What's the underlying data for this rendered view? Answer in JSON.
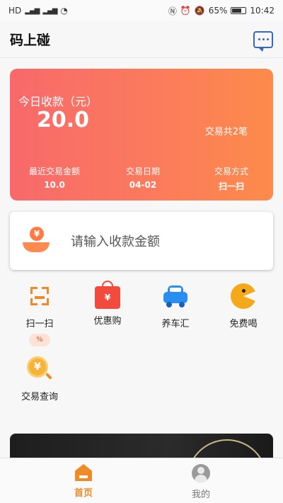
{
  "status_bar": {
    "left": "HD",
    "battery": "65%",
    "time": "10:42"
  },
  "header": {
    "title": "码上碰",
    "message_icon": "message-icon"
  },
  "summary": {
    "label": "今日收款（元）",
    "amount": "20.0",
    "count_text": "交易共2笔",
    "stats": [
      {
        "label": "最近交易金额",
        "value": "10.0"
      },
      {
        "label": "交易日期",
        "value": "04-02"
      },
      {
        "label": "交易方式",
        "value": "扫一扫"
      }
    ]
  },
  "amount_input": {
    "placeholder": "请输入收款金额",
    "icon": "hand-coin-icon"
  },
  "features": [
    {
      "label": "扫一扫",
      "icon": "scan-icon",
      "badge": "%"
    },
    {
      "label": "优惠购",
      "icon": "shopping-bag-icon"
    },
    {
      "label": "养车汇",
      "icon": "car-icon"
    },
    {
      "label": "免费喝",
      "icon": "pacman-icon"
    },
    {
      "label": "交易查询",
      "icon": "coin-search-icon"
    }
  ],
  "colors": {
    "accent": "#f08a24",
    "card_start": "#f8696b",
    "card_end": "#fd8b4b"
  },
  "tabbar": {
    "tabs": [
      {
        "label": "首页",
        "icon": "home-icon",
        "active": true
      },
      {
        "label": "我的",
        "icon": "user-icon",
        "active": false
      }
    ]
  }
}
